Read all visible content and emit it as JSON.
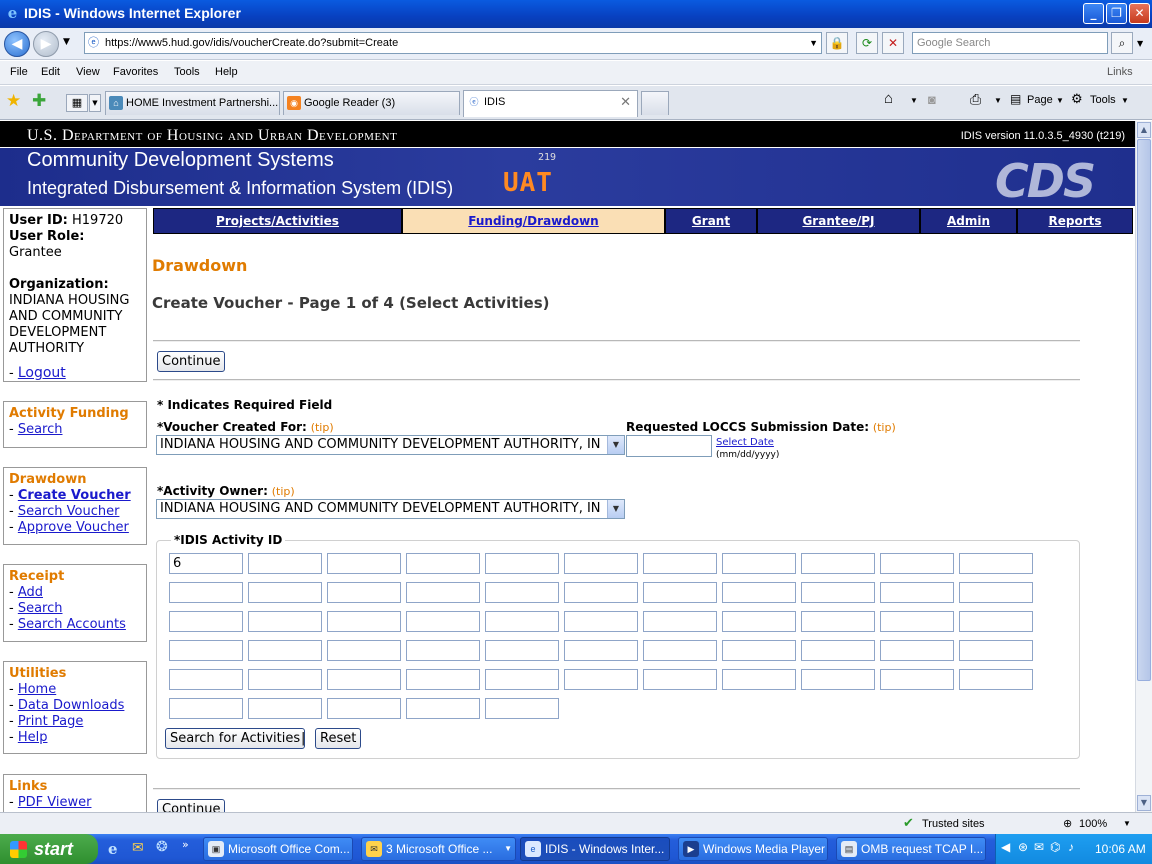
{
  "window": {
    "title": "IDIS - Windows Internet Explorer",
    "min": "_",
    "max": "❐",
    "close": "✕"
  },
  "address": {
    "url": "https://www5.hud.gov/idis/voucherCreate.do?submit=Create",
    "search_placeholder": "Google Search"
  },
  "menu": [
    "File",
    "Edit",
    "View",
    "Favorites",
    "Tools",
    "Help"
  ],
  "menu_links": "Links",
  "tabs": [
    {
      "label": "HOME Investment Partnershi..."
    },
    {
      "label": "Google Reader (3)"
    },
    {
      "label": "IDIS"
    }
  ],
  "toolbar": {
    "page": "Page",
    "tools": "Tools"
  },
  "header": {
    "dept": "U.S. Department of Housing and Urban Development",
    "version": "IDIS version 11.0.3.5_4930 (t219)",
    "line1": "Community Development Systems",
    "line2": "Integrated Disbursement & Information System (IDIS)",
    "uat": "UAT",
    "num": "219",
    "logo": "CDS"
  },
  "user": {
    "id_label": "User ID:",
    "id": "H19720",
    "role_label": "User Role:",
    "role": "Grantee",
    "org_label": "Organization:",
    "org_lines": [
      "INDIANA HOUSING",
      "AND COMMUNITY",
      "DEVELOPMENT",
      "AUTHORITY"
    ],
    "logout": "Logout"
  },
  "sidebar": {
    "activity_funding": {
      "title": "Activity Funding",
      "items": [
        "Search"
      ]
    },
    "drawdown": {
      "title": "Drawdown",
      "items": [
        "Create Voucher",
        "Search Voucher",
        "Approve Voucher"
      ]
    },
    "receipt": {
      "title": "Receipt",
      "items": [
        "Add",
        "Search",
        "Search Accounts"
      ]
    },
    "utilities": {
      "title": "Utilities",
      "items": [
        "Home",
        "Data Downloads",
        "Print Page",
        "Help"
      ]
    },
    "links": {
      "title": "Links",
      "items": [
        "PDF Viewer"
      ]
    }
  },
  "nav": [
    "Projects/Activities",
    "Funding/Drawdown",
    "Grant",
    "Grantee/PJ",
    "Admin",
    "Reports"
  ],
  "content": {
    "title": "Drawdown",
    "subtitle": "Create Voucher - Page 1 of 4 (Select Activities)",
    "continue": "Continue",
    "required_note": "* Indicates Required Field",
    "voucher_for_label": "*Voucher Created For:",
    "tip": "(tip)",
    "voucher_for_value": "INDIANA HOUSING AND COMMUNITY DEVELOPMENT AUTHORITY, IN",
    "loccs_label": "Requested LOCCS Submission Date:",
    "select_date": "Select Date",
    "date_format": "(mm/dd/yyyy)",
    "owner_label": "*Activity Owner:",
    "owner_value": "INDIANA HOUSING AND COMMUNITY DEVELOPMENT AUTHORITY, IN",
    "activity_legend": "*IDIS Activity ID",
    "activity_values": [
      "6"
    ],
    "search_btn": "Search for Activities",
    "separator": "|",
    "reset_btn": "Reset"
  },
  "status": {
    "zone": "Trusted sites",
    "zoom": "100%"
  },
  "taskbar": {
    "start": "start",
    "items": [
      "Microsoft Office Com...",
      "3 Microsoft Office ...",
      "IDIS - Windows Inter...",
      "Windows Media Player",
      "OMB request TCAP I..."
    ],
    "clock": "10:06 AM"
  }
}
